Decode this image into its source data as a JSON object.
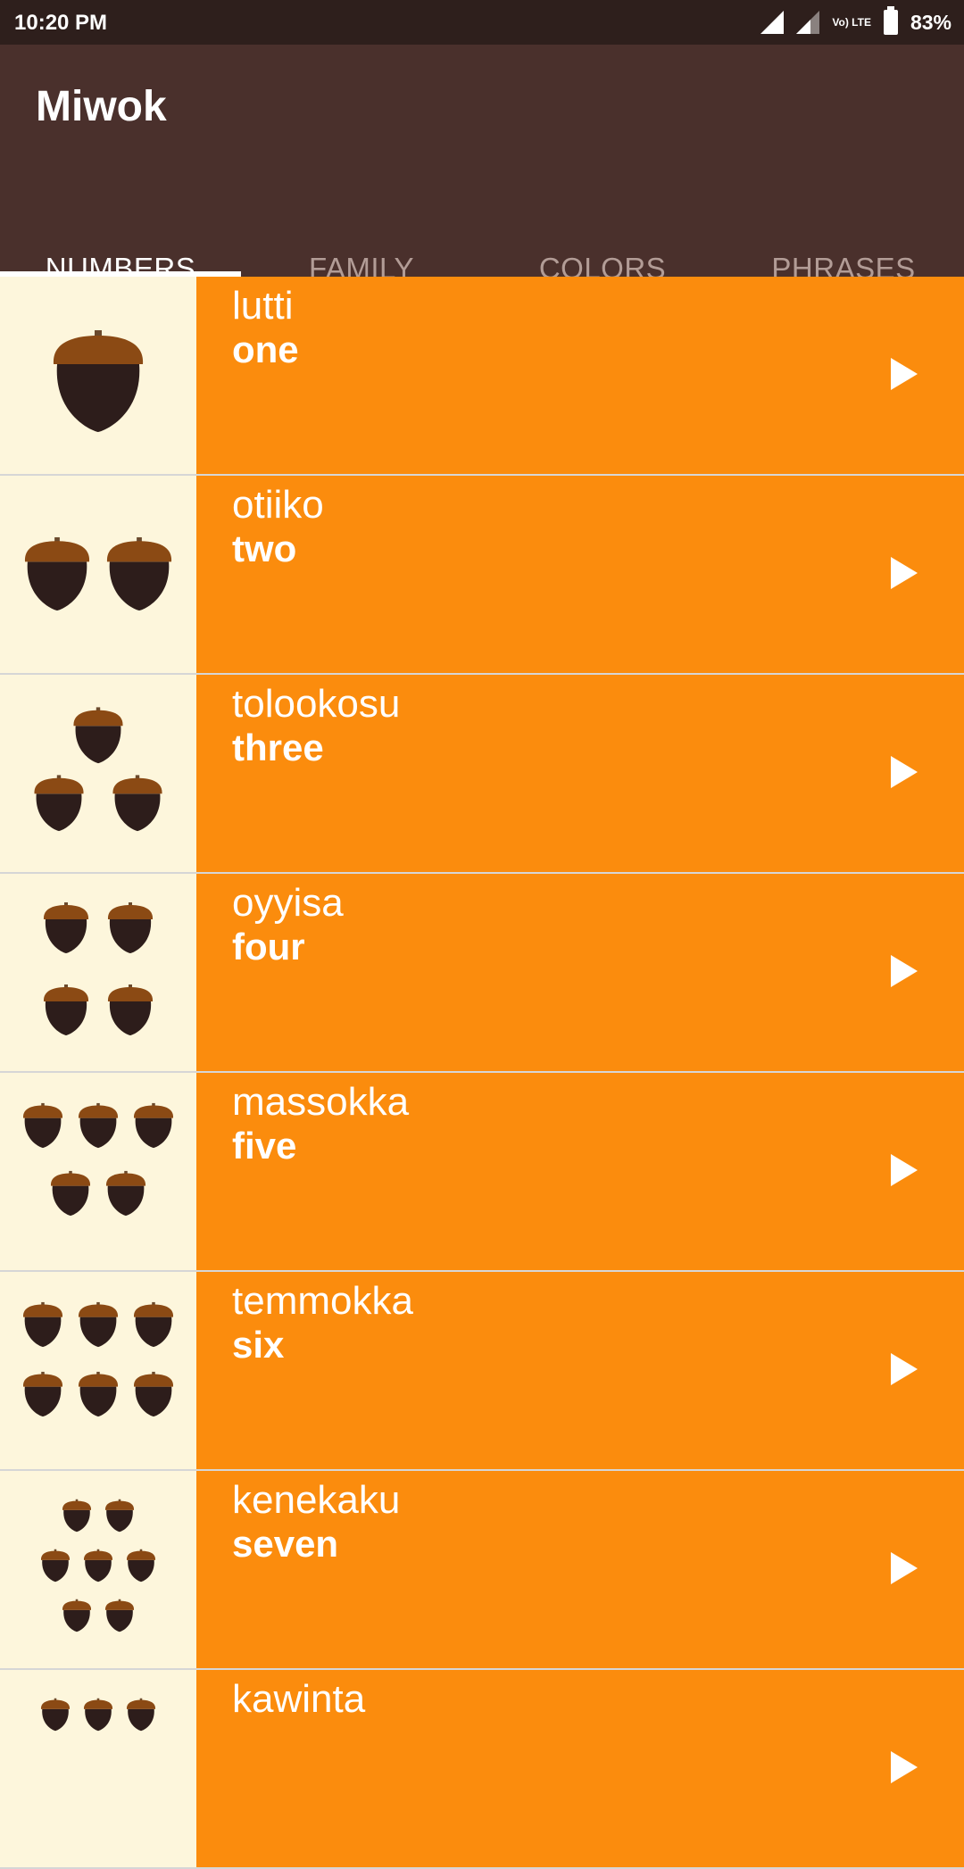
{
  "status_bar": {
    "time": "10:20 PM",
    "network_label": "Vo) LTE",
    "battery": "83%"
  },
  "app_bar": {
    "title": "Miwok",
    "tabs": [
      {
        "label": "NUMBERS",
        "active": true
      },
      {
        "label": "FAMILY",
        "active": false
      },
      {
        "label": "COLORS",
        "active": false
      },
      {
        "label": "PHRASES",
        "active": false
      }
    ]
  },
  "colors": {
    "status_bar": "#2e1f1c",
    "app_bar": "#4a302c",
    "row_background": "#fb8c0d",
    "image_background": "#fdf6dc"
  },
  "list": {
    "items": [
      {
        "miwok": "lutti",
        "english": "one",
        "icon": "acorn-1-icon"
      },
      {
        "miwok": "otiiko",
        "english": "two",
        "icon": "acorn-2-icon"
      },
      {
        "miwok": "tolookosu",
        "english": "three",
        "icon": "acorn-3-icon"
      },
      {
        "miwok": "oyyisa",
        "english": "four",
        "icon": "acorn-4-icon"
      },
      {
        "miwok": "massokka",
        "english": "five",
        "icon": "acorn-5-icon"
      },
      {
        "miwok": "temmokka",
        "english": "six",
        "icon": "acorn-6-icon"
      },
      {
        "miwok": "kenekaku",
        "english": "seven",
        "icon": "acorn-7-icon"
      },
      {
        "miwok": "kawinta",
        "english": "",
        "icon": "acorn-8-icon"
      }
    ]
  }
}
